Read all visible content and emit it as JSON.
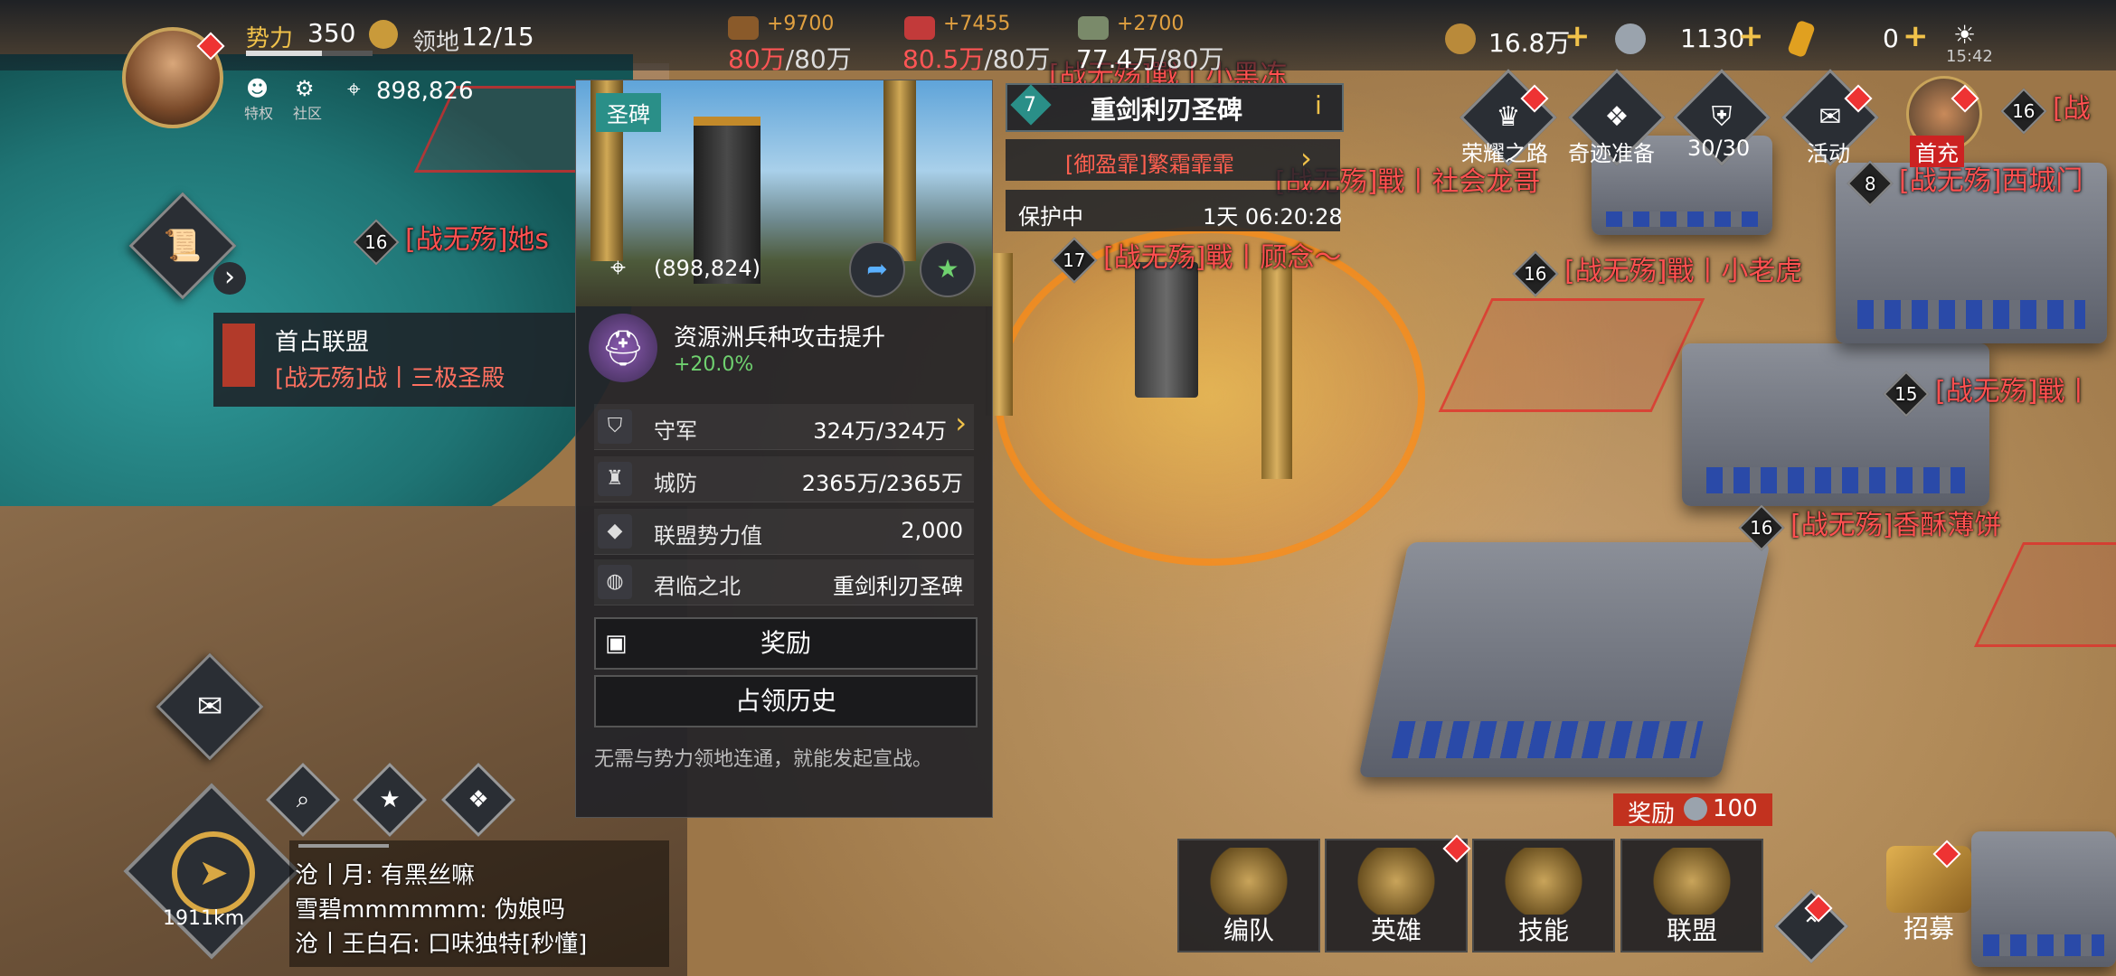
{
  "player": {
    "power_label": "势力",
    "power_value": "350",
    "territory_label": "领地",
    "territory_value": "12/15",
    "privilege_label": "特权",
    "community_label": "社区",
    "coords": "898,826"
  },
  "resources": [
    {
      "name": "wood-icon",
      "gain": "+9700",
      "current": "80万",
      "cap": "/80万"
    },
    {
      "name": "meat-icon",
      "gain": "+7455",
      "current": "80.5万",
      "cap": "/80万"
    },
    {
      "name": "stone-icon",
      "gain": "+2700",
      "current": "77.4万",
      "cap": "/80万"
    }
  ],
  "currencies": [
    {
      "name": "gold-coin-icon",
      "value": "16.8万",
      "plus": "+"
    },
    {
      "name": "silver-coin-icon",
      "value": "1130",
      "plus": "+"
    },
    {
      "name": "gem-icon",
      "value": "0",
      "plus": "+"
    }
  ],
  "clock": "15:42",
  "top_menu": [
    {
      "label": "荣耀之路"
    },
    {
      "label": "奇迹准备"
    },
    {
      "label": "30/30"
    },
    {
      "label": "活动"
    },
    {
      "label": "首充"
    }
  ],
  "map_labels": [
    {
      "level": "16",
      "text": "[战无殇]她s"
    },
    {
      "level": "8",
      "text": "[战无殇]西城门"
    },
    {
      "level": "16",
      "text": "[战无殇]戰丨小老虎"
    },
    {
      "level": "15",
      "text": "[战无殇]戰丨"
    },
    {
      "level": "16",
      "text": "[战无殇]香酥薄饼"
    },
    {
      "level": "17",
      "text": "[战无殇]戰丨顾念～"
    },
    {
      "level": "",
      "text": "[战无殇]戰丨社会龙哥"
    },
    {
      "level": "16",
      "text": "[战"
    },
    {
      "level": "",
      "text": "[战无殇]戰丨小黑冻"
    }
  ],
  "first_alliance": {
    "title": "首占联盟",
    "name": "[战无殇]战丨三极圣殿"
  },
  "target": {
    "level": "7",
    "name": "重剑利刃圣碑",
    "owner": "[御盈霏]繁霜霏霏",
    "status": "保护中",
    "timer": "1天 06:20:28"
  },
  "panel": {
    "tag": "圣碑",
    "coords": "(898,824)",
    "buff_title": "资源洲兵种攻击提升",
    "buff_value": "+20.0%",
    "rows": [
      {
        "icon": "helmet-icon",
        "label": "守军",
        "value": "324万/324万"
      },
      {
        "icon": "fortress-icon",
        "label": "城防",
        "value": "2365万/2365万"
      },
      {
        "icon": "diamond-icon",
        "label": "联盟势力值",
        "value": "2,000"
      },
      {
        "icon": "globe-icon",
        "label": "君临之北",
        "value": "重剑利刃圣碑"
      }
    ],
    "reward_btn": "奖励",
    "history_btn": "占领历史",
    "note": "无需与势力领地连通，就能发起宣战。"
  },
  "distance": "1911km",
  "chat": [
    {
      "text": "沧丨月: 有黑丝嘛"
    },
    {
      "text": "雪碧mmmmmm: 伪娘吗"
    },
    {
      "text": "沧丨王白石: 口味独特[秒懂]"
    }
  ],
  "reward_badge": {
    "label": "奖励",
    "value": "100"
  },
  "bottom_menu": [
    {
      "label": "编队"
    },
    {
      "label": "英雄"
    },
    {
      "label": "技能"
    },
    {
      "label": "联盟"
    },
    {
      "label": "招募"
    }
  ],
  "colors": {
    "accent_gold": "#f1c24a",
    "enemy_red": "#ff5050",
    "buff_green": "#6fd16f",
    "teal": "#2a8f88"
  }
}
